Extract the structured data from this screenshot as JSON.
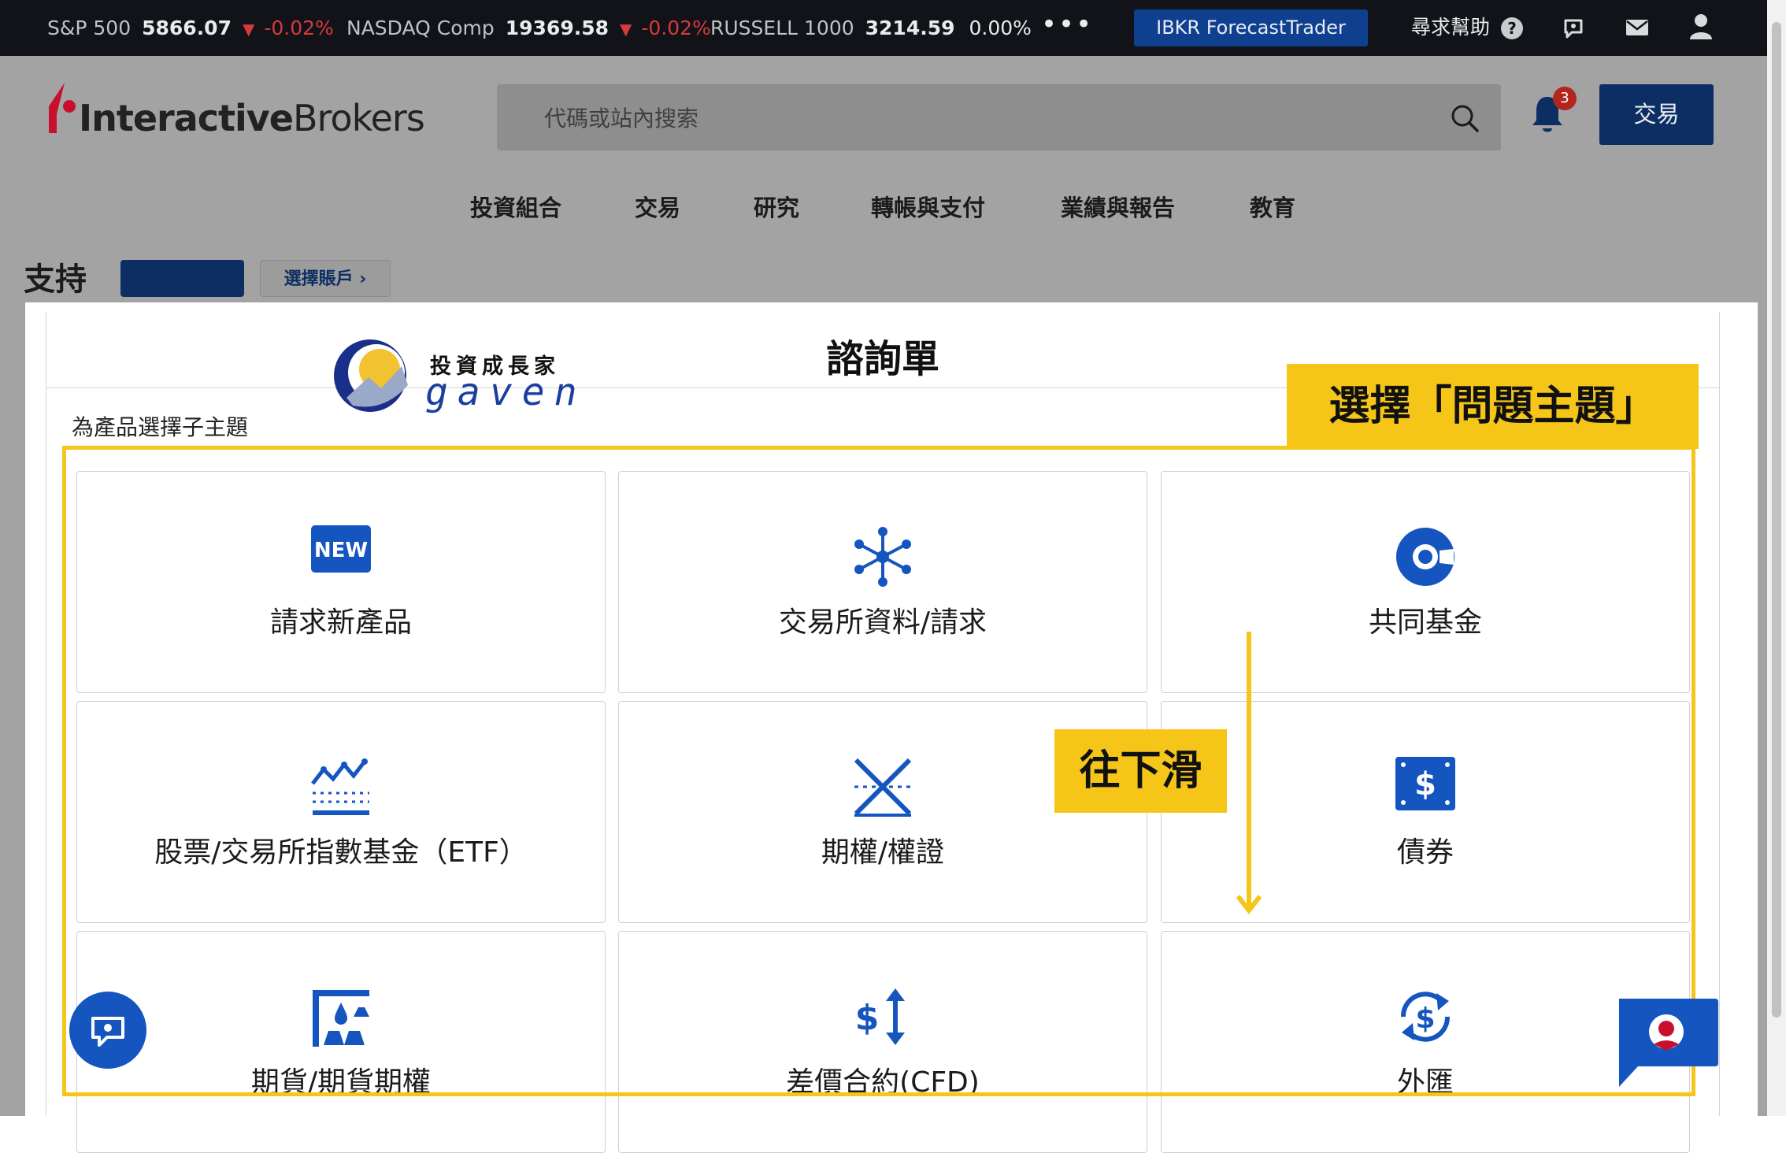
{
  "ticker": {
    "items": [
      {
        "name": "S&P 500",
        "value": "5866.07",
        "change": "-0.02%"
      },
      {
        "name": "NASDAQ Comp",
        "value": "19369.58",
        "change": "-0.02%"
      },
      {
        "name": "RUSSELL 1000",
        "value": "3214.59",
        "change": "0.00%"
      }
    ],
    "more_label": "•••",
    "forecast_label": "IBKR ForecastTrader",
    "help_label": "尋求幫助",
    "help_mark": "?"
  },
  "header": {
    "logo_interactive": "Interactive",
    "logo_brokers": "Brokers",
    "search_placeholder": "代碼或站內搜索",
    "notification_count": "3",
    "trade_label": "交易",
    "nav": [
      "投資組合",
      "交易",
      "研究",
      "轉帳與支付",
      "業績與報告",
      "教育"
    ]
  },
  "page": {
    "title": "支持",
    "select_account": "選擇賬戶",
    "form_title": "諮詢單",
    "subtopic_label": "為產品選擇子主題"
  },
  "tiles": [
    {
      "label": "請求新產品",
      "icon": "new-badge-icon",
      "new_text": "NEW"
    },
    {
      "label": "交易所資料/請求",
      "icon": "network-nodes-icon"
    },
    {
      "label": "共同基金",
      "icon": "pie-chart-icon"
    },
    {
      "label": "股票/交易所指數基金（ETF）",
      "icon": "stock-chart-icon"
    },
    {
      "label": "期權/權證",
      "icon": "crossed-lines-icon"
    },
    {
      "label": "債券",
      "icon": "dollar-bond-icon"
    },
    {
      "label": "期貨/期貨期權",
      "icon": "commodities-icon"
    },
    {
      "label": "差價合約(CFD)",
      "icon": "dollar-arrows-icon"
    },
    {
      "label": "外匯",
      "icon": "currency-exchange-icon"
    }
  ],
  "annotations": {
    "select_topic": "選擇「問題主題」",
    "scroll_down": "往下滑",
    "watermark_cn": "投資成長家",
    "watermark_en": "GAVEN"
  },
  "colors": {
    "brand_navy": "#0d2e63",
    "icon_blue": "#1555c0",
    "highlight_yellow": "#f5c518",
    "negative_red": "#d63a3a"
  }
}
